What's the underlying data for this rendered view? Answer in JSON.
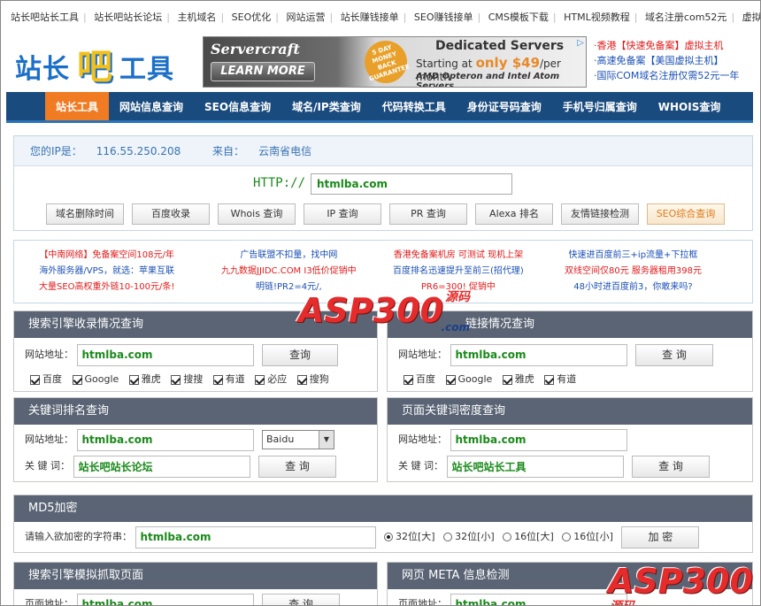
{
  "top_links": [
    "站长吧站长工具",
    "站长吧站长论坛",
    "主机域名",
    "SEO优化",
    "网站运营",
    "站长赚钱接单",
    "SEO赚钱接单",
    "CMS模板下载",
    "HTML视频教程",
    "域名注册com52元",
    "虚拟主机"
  ],
  "logo": {
    "text1": "站长",
    "text2": "吧",
    "text3": "工具"
  },
  "banner": {
    "brand": "Servercraft",
    "learn_more": "LEARN MORE",
    "badge": "5 DAY MONEY BACK GUARANTEE",
    "title": "Dedicated Servers",
    "price_prefix": "Starting at",
    "price": "only $49",
    "price_suffix": "/per month",
    "cpu": "AMD Opteron and Intel Atom Servers."
  },
  "side_ads": [
    "香港【快速免备案】虚拟主机",
    "高速免备案【美国虚拟主机】",
    "国际COM域名注册仅需52元一年"
  ],
  "nav": [
    "站长工具",
    "网站信息查询",
    "SEO信息查询",
    "域名/IP类查询",
    "代码转换工具",
    "身份证号码查询",
    "手机号归属查询",
    "WHOIS查询"
  ],
  "ipinfo": {
    "ip_label": "您的IP是：",
    "ip": "116.55.250.208",
    "from_label": "来自：",
    "from": "云南省电信"
  },
  "http": {
    "label": "HTTP://",
    "value": "htmlba.com"
  },
  "tools": [
    "域名删除时间",
    "百度收录",
    "Whois 查询",
    "IP 查询",
    "PR 查询",
    "Alexa 排名",
    "友情链接检测",
    "SEO综合查询"
  ],
  "ads": [
    [
      "【中南网络】免备案空间108元/年",
      "海外服务器/VPS，就选：苹果互联",
      "大量SEO高权重外链10-100元/条!"
    ],
    [
      "广告联盟不扣量，找中网",
      "九九数据JJIDC.COM I3低价促销中",
      "明链!PR2=4元/,"
    ],
    [
      "香港免备案机房 可测试 现机上架",
      "百度排名迅速提升至前三(招代理)",
      "PR6=300! 促销中"
    ],
    [
      "快速进百度前三+ip流量+下拉框",
      "双线空间仅80元 服务器租用398元",
      "48小时进百度前3，你敢来吗?"
    ]
  ],
  "panel1": {
    "title": "搜索引擎收录情况查询",
    "label": "网站地址：",
    "value": "htmlba.com",
    "button": "查询",
    "checks": [
      "百度",
      "Google",
      "雅虎",
      "搜搜",
      "有道",
      "必应",
      "搜狗"
    ]
  },
  "panel2": {
    "title_visible": "链接情况查询",
    "label": "网站地址：",
    "value": "htmlba.com",
    "button": "查 询",
    "checks": [
      "百度",
      "Google",
      "雅虎",
      "有道"
    ]
  },
  "panel3": {
    "title": "关键词排名查询",
    "label": "网站地址：",
    "value": "htmlba.com",
    "select": "Baidu",
    "kw_label": "关 键 词：",
    "kw_value": "站长吧站长论坛",
    "button": "查 询"
  },
  "panel4": {
    "title": "页面关键词密度查询",
    "label": "网站地址：",
    "value": "htmlba.com",
    "kw_label": "关 键 词：",
    "kw_value": "站长吧站长工具",
    "button": "查 询"
  },
  "panel5": {
    "title": "MD5加密",
    "label": "请输入欲加密的字符串：",
    "value": "htmlba.com",
    "options": [
      "32位[大]",
      "32位[小]",
      "16位[大]",
      "16位[小]"
    ],
    "button": "加 密"
  },
  "panel6": {
    "title": "搜索引擎模拟抓取页面",
    "label": "页面地址：",
    "value": "htmlba.com",
    "button": "查 询"
  },
  "panel7": {
    "title": "网页 META 信息检测",
    "label": "页面地址：",
    "value": "htmlba.com"
  },
  "watermark": {
    "text": "ASP300",
    "suffix": "源码",
    "domain": ".com"
  }
}
